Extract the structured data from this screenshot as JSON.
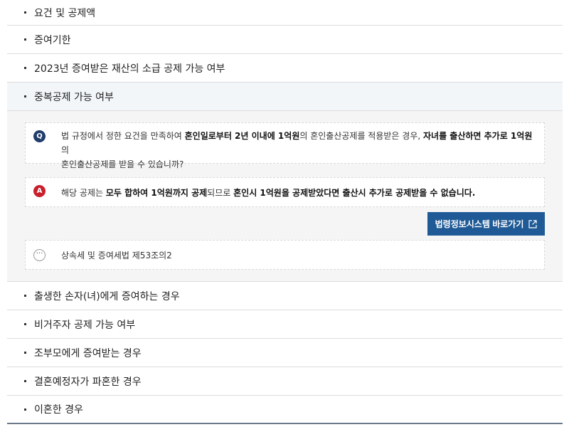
{
  "accordion": {
    "items": [
      {
        "label": "요건 및 공제액"
      },
      {
        "label": "증여기한"
      },
      {
        "label": "2023년 증여받은 재산의 소급 공제 가능 여부"
      },
      {
        "label": "중복공제 가능 여부"
      },
      {
        "label": "출생한 손자(녀)에게 증여하는 경우"
      },
      {
        "label": "비거주자 공제 가능 여부"
      },
      {
        "label": "조부모에게 증여받는 경우"
      },
      {
        "label": "결혼예정자가 파혼한 경우"
      },
      {
        "label": "이혼한 경우"
      }
    ],
    "expanded_index": 3
  },
  "panel": {
    "question": {
      "badge": "Q",
      "line1": [
        "법 규정에서 정한 요건을 만족하여 ",
        "혼인일로부터 2년 이내에 1억원",
        "의 혼인출산공제를 적용받은 경우, ",
        "자녀를 출산하면 추가로 1억원",
        "의"
      ],
      "line2": "혼인출산공제를 받을 수 있습니까?"
    },
    "answer": {
      "badge": "A",
      "parts": [
        "해당 공제는 ",
        "모두 합하여 1억원까지 공제",
        "되므로 ",
        "혼인시 1억원을 공제받았다면 출산시 추가로 공제받을 수 없습니다."
      ]
    },
    "law_button_label": "법령정보시스템 바로가기",
    "law_reference": "상속세 및 증여세법 제53조의2",
    "colors": {
      "badge_q": "#1f3c6b",
      "badge_a": "#c8202c",
      "button": "#1f5a96"
    }
  }
}
